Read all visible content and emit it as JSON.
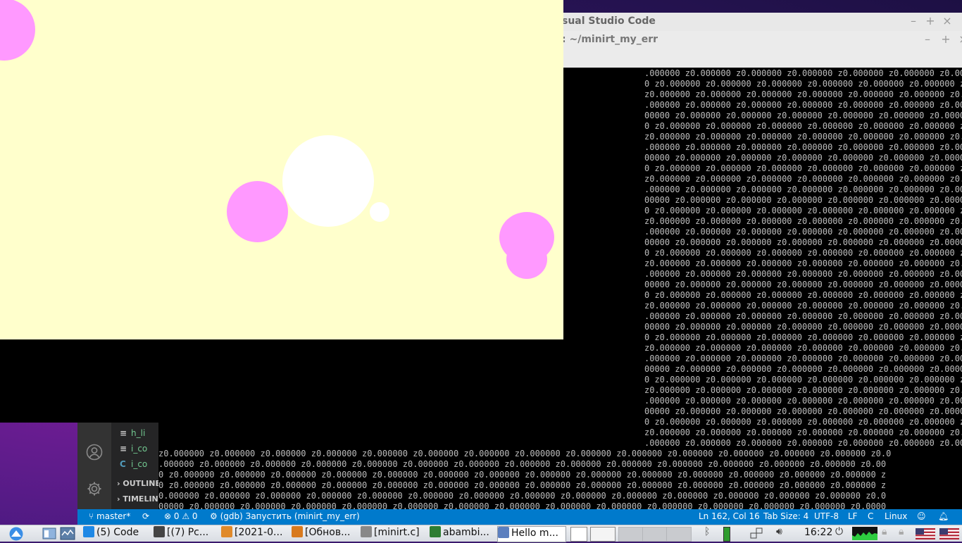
{
  "vscode": {
    "title": "sual Studio Code",
    "terminal_title": ": ~/minirt_my_err",
    "sidebar": {
      "files": [
        {
          "icon": "≡",
          "label": "h_li"
        },
        {
          "icon": "≡",
          "label": "i_co"
        },
        {
          "icon": "C",
          "label": "i_co"
        }
      ],
      "sections": [
        "OUTLINE",
        "TIMELINE"
      ]
    },
    "terminal": {
      "lines_upper": [
        ".000000 z0.000000 z0.000000 z0.000000 z0.000000 z0.000000 z0.000000",
        "0 z0.000000 z0.000000 z0.000000 z0.000000 z0.000000 z0.000000 z0.000000 z0.",
        "z0.000000 z0.000000 z0.000000 z0.000000 z0.000000 z0.000000 z0.000000 z0.000",
        ".000000 z0.000000 z0.000000 z0.000000 z0.000000 z0.000000 z0.000000 z0.00000",
        "00000 z0.000000 z0.000000 z0.000000 z0.000000 z0.000000 z0.000000 z0.000000",
        "0 z0.000000 z0.000000 z0.000000 z0.000000 z0.000000 z0.000000 z0.000000 z0.",
        "z0.000000 z0.000000 z0.000000 z0.000000 z0.000000 z0.000000 z0.000000 z0.000",
        ".000000 z0.000000 z0.000000 z0.000000 z0.000000 z0.000000 z0.000000 z0.00000",
        "00000 z0.000000 z0.000000 z0.000000 z0.000000 z0.000000 z0.000000 z0.000000",
        "0 z0.000000 z0.000000 z0.000000 z0.000000 z0.000000 z0.000000 z0.000000 z0.",
        "z0.000000 z0.000000 z0.000000 z0.000000 z0.000000 z0.000000 z0.000000 z0.000",
        ".000000 z0.000000 z0.000000 z0.000000 z0.000000 z0.000000 z0.000000 z0.00000",
        "00000 z0.000000 z0.000000 z0.000000 z0.000000 z0.000000 z0.000000 z0.000000",
        "0 z0.000000 z0.000000 z0.000000 z0.000000 z0.000000 z0.000000 z0.000000 z0.",
        "z0.000000 z0.000000 z0.000000 z0.000000 z0.000000 z0.000000 z0.000000 z0.000",
        ".000000 z0.000000 z0.000000 z0.000000 z0.000000 z0.000000 z0.000000 z0.00000",
        "00000 z0.000000 z0.000000 z0.000000 z0.000000 z0.000000 z0.000000 z0.000000",
        "0 z0.000000 z0.000000 z0.000000 z0.000000 z0.000000 z0.000000 z0.000000 z0.",
        "z0.000000 z0.000000 z0.000000 z0.000000 z0.000000 z0.000000 z0.000000 z0.000",
        ".000000 z0.000000 z0.000000 z0.000000 z0.000000 z0.000000 z0.000000 z0.00000",
        "00000 z0.000000 z0.000000 z0.000000 z0.000000 z0.000000 z0.000000 z0.000000",
        "0 z0.000000 z0.000000 z0.000000 z0.000000 z0.000000 z0.000000 z0.000000 z0.",
        "z0.000000 z0.000000 z0.000000 z0.000000 z0.000000 z0.000000 z0.000000 z0.000",
        ".000000 z0.000000 z0.000000 z0.000000 z0.000000 z0.000000 z0.000000 z0.00000",
        "00000 z0.000000 z0.000000 z0.000000 z0.000000 z0.000000 z0.000000 z0.000000",
        "0 z0.000000 z0.000000 z0.000000 z0.000000 z0.000000 z0.000000 z0.000000 z0.",
        "z0.000000 z0.000000 z0.000000 z0.000000 z0.000000 z0.000000 z0.000000 z0.000",
        ".000000 z0.000000 z0.000000 z0.000000 z0.000000 z0.000000 z0.000000 z0.00000",
        "00000 z0.000000 z0.000000 z0.000000 z0.000000 z0.000000 z0.000000 z0.000000",
        "0 z0.000000 z0.000000 z0.000000 z0.000000 z0.000000 z0.000000 z0.000000 z0.",
        "z0.000000 z0.000000 z0.000000 z0.000000 z0.000000 z0.000000 z0.000000 z0.000",
        ".000000 z0.000000 z0.000000 z0.000000 z0.000000 z0.000000 z0.000000 z0.00000",
        "00000 z0.000000 z0.000000 z0.000000 z0.000000 z0.000000 z0.000000 z0.000000",
        "0 z0.000000 z0.000000 z0.000000 z0.000000 z0.000000 z0.000000 z0.000000 z0.",
        "z0.000000 z0.000000 z0.000000 z0.000000 z0.000000 z0.000000 z0.000000 z0.000",
        ".000000 z0.000000 z0.000000 z0.000000 z0.000000 z0.000000 z0.000000 z0.00000"
      ],
      "lines_lower": [
        "z0.000000 z0.000000 z0.000000 z0.000000 z0.000000 z0.000000 z0.000000 z0.000000 z0.000000 z0.000000 z0.000000 z0.000000 z0.000000 z0.000000 z0.0",
        ".000000 z0.000000 z0.000000 z0.000000 z0.000000 z0.000000 z0.000000 z0.000000 z0.000000 z0.000000 z0.000000 z0.000000 z0.000000 z0.000000 z0.00",
        "0 z0.000000 z0.000000 z0.000000 z0.000000 z0.000000 z0.000000 z0.000000 z0.000000 z0.000000 z0.000000 z0.000000 z0.000000 z0.000000 z0.000000 z",
        "0 z0.000000 z0.000000 z0.000000 z0.000000 z0.000000 z0.000000 z0.000000 z0.000000 z0.000000 z0.000000 z0.000000 z0.000000 z0.000000 z0.000000 z",
        "0.000000 z0.000000 z0.000000 z0.000000 z0.000000 z0.000000 z0.000000 z0.000000 z0.000000 z0.000000 z0.000000 z0.000000 z0.000000 z0.000000 z0.0",
        "00000 z0.000000 z0.000000 z0.000000 z0.000000 z0.000000 z0.000000 z0.000000 z0.000000 z0.000000 z0.000000 z0.000000 z0.000000 z0.000000 z0.0000",
        "00 z0.000000 z0.000000 z0.000000 z0.000000 z0.000000 z0.000000 z0.000000 z0.000000 z0.000000 z0.000000 z0.000000 z0.000000 z0.000000 z0.000000"
      ],
      "last_line": "z0.000000 z0.000000 z0.000000 z0.000000"
    },
    "statusbar": {
      "branch": "master*",
      "problems": "⊗ 0 ⚠ 0",
      "debug": "(gdb) Запустить (minirt_my_err)",
      "position": "Ln 162, Col 16",
      "tab_size": "Tab Size: 4",
      "encoding": "UTF-8",
      "eol": "LF",
      "language": "C",
      "os": "Linux"
    }
  },
  "render": {
    "background": "#ffffcc",
    "sphere_colors": [
      "#ff99ff",
      "#ffffff"
    ]
  },
  "taskbar": {
    "tasks": [
      {
        "label": "(5) Code",
        "icon": "vscode-icon",
        "color": "#1e88e5"
      },
      {
        "label": "[(7) Pc...",
        "icon": "folder-icon",
        "color": "#444444"
      },
      {
        "label": "[2021-0...",
        "icon": "image-viewer-icon",
        "color": "#e08a2a"
      },
      {
        "label": "[Обнов...",
        "icon": "package-icon",
        "color": "#d87a1e"
      },
      {
        "label": "[minirt.c]",
        "icon": "text-editor-icon",
        "color": "#888888"
      },
      {
        "label": "abambi...",
        "icon": "terminal-icon",
        "color": "#2e7d32"
      },
      {
        "label": "Hello m...",
        "icon": "window-icon",
        "color": "#5b7fbf"
      }
    ],
    "clock": "16:22"
  }
}
